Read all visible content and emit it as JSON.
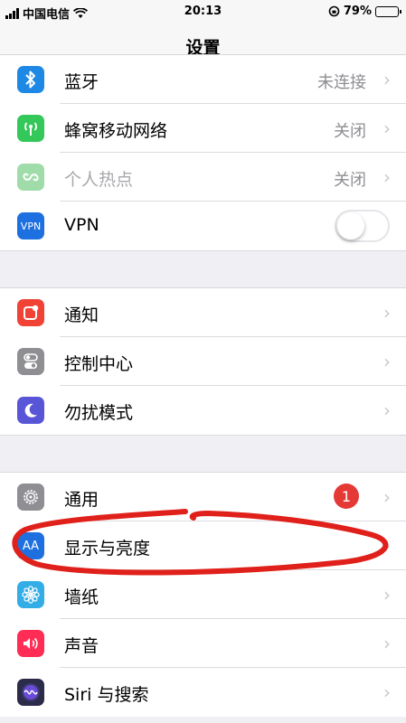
{
  "status_bar": {
    "carrier": "中国电信",
    "time": "20:13",
    "battery": "79%",
    "battery_level": 0.79
  },
  "nav": {
    "title": "设置"
  },
  "groups": [
    {
      "rows": [
        {
          "label": "蓝牙",
          "value": "未连接",
          "icon": "bluetooth-icon",
          "color": "#1e88e5"
        },
        {
          "label": "蜂窝移动网络",
          "value": "关闭",
          "icon": "cellular-icon",
          "color": "#34c759"
        },
        {
          "label": "个人热点",
          "value": "关闭",
          "icon": "hotspot-icon",
          "color": "#9fdca9"
        },
        {
          "label": "VPN",
          "icon": "vpn-icon",
          "icon_text": "VPN",
          "color": "#1e6fe0",
          "toggle": "off"
        }
      ]
    },
    {
      "rows": [
        {
          "label": "通知",
          "icon": "notifications-icon",
          "color": "#f04336"
        },
        {
          "label": "控制中心",
          "icon": "control-center-icon",
          "color": "#8e8e93"
        },
        {
          "label": "勿扰模式",
          "icon": "moon-icon",
          "color": "#5856d6"
        }
      ]
    },
    {
      "rows": [
        {
          "label": "通用",
          "icon": "gear-icon",
          "color": "#8e8e93",
          "badge": "1"
        },
        {
          "label": "显示与亮度",
          "icon": "display-icon",
          "icon_text": "AA",
          "color": "#1e6fe0"
        },
        {
          "label": "墙纸",
          "icon": "wallpaper-icon",
          "color": "#32ade6"
        },
        {
          "label": "声音",
          "icon": "sound-icon",
          "color": "#ff2d55"
        },
        {
          "label": "Siri 与搜索",
          "icon": "siri-icon",
          "color": "#2c2c4a"
        }
      ]
    }
  ],
  "annotation_color": "#e0201a"
}
